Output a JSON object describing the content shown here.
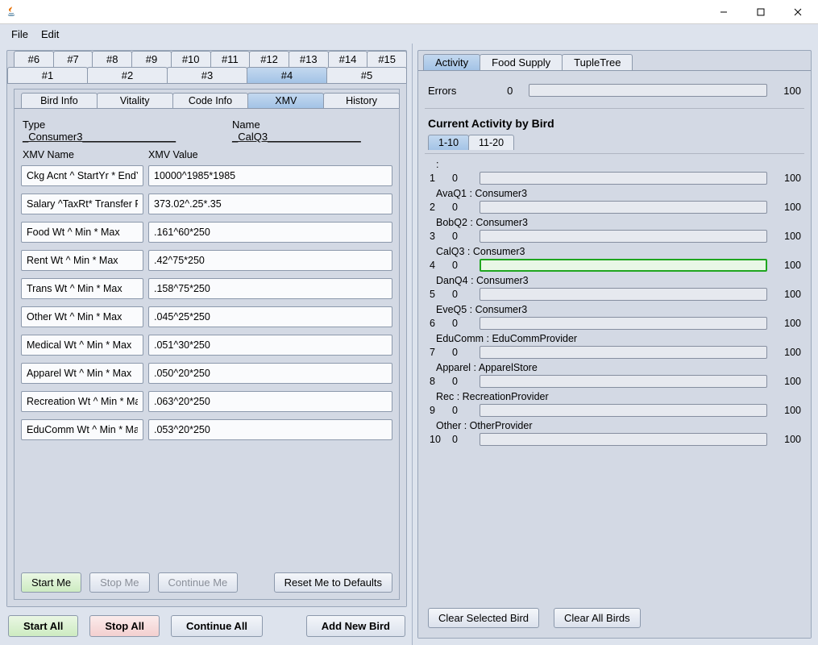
{
  "window": {
    "min": "—",
    "max": "▢",
    "close": "✕"
  },
  "menu": {
    "file": "File",
    "edit": "Edit"
  },
  "numTabs": {
    "row1": [
      "#6",
      "#7",
      "#8",
      "#9",
      "#10",
      "#11",
      "#12",
      "#13",
      "#14",
      "#15"
    ],
    "row2": [
      "#1",
      "#2",
      "#3",
      "#4",
      "#5"
    ],
    "active": "#4"
  },
  "infoTabs": {
    "items": [
      "Bird Info",
      "Vitality",
      "Code Info",
      "XMV",
      "History"
    ],
    "active": "XMV"
  },
  "typeLine": {
    "typeLabel": "Type",
    "typeVal": "_Consumer3________________",
    "nameLabel": "Name",
    "nameVal": "_CalQ3________________"
  },
  "xmvHeader": {
    "name": "XMV Name",
    "value": "XMV Value"
  },
  "xmv": [
    {
      "k": "Ckg Acnt ^ StartYr * EndYr",
      "v": "10000^1985*1985"
    },
    {
      "k": "Salary ^TaxRt* Transfer Rt",
      "v": "373.02^.25*.35"
    },
    {
      "k": "Food Wt ^ Min * Max",
      "v": ".161^60*250"
    },
    {
      "k": "Rent Wt ^ Min * Max",
      "v": ".42^75*250"
    },
    {
      "k": "Trans Wt ^ Min * Max",
      "v": ".158^75*250"
    },
    {
      "k": "Other Wt ^ Min * Max",
      "v": ".045^25*250"
    },
    {
      "k": "Medical Wt ^ Min * Max",
      "v": ".051^30*250"
    },
    {
      "k": "Apparel Wt ^ Min * Max",
      "v": ".050^20*250"
    },
    {
      "k": "Recreation Wt ^ Min * Max",
      "v": ".063^20*250"
    },
    {
      "k": "EduComm Wt ^ Min * Max",
      "v": ".053^20*250"
    }
  ],
  "leftBtns": {
    "start": "Start Me",
    "stop": "Stop Me",
    "cont": "Continue Me",
    "reset": "Reset Me to Defaults"
  },
  "globalBtns": {
    "startAll": "Start All",
    "stopAll": "Stop All",
    "contAll": "Continue All",
    "add": "Add New Bird"
  },
  "rightTabs": {
    "items": [
      "Activity",
      "Food Supply",
      "TupleTree"
    ],
    "active": "Activity"
  },
  "errors": {
    "label": "Errors",
    "lo": "0",
    "hi": "100"
  },
  "activityTitle": "Current Activity by Bird",
  "rangeTabs": {
    "items": [
      "1-10",
      "11-20"
    ],
    "active": "1-10"
  },
  "birds": [
    {
      "idx": "1",
      "name": ":",
      "lo": "0",
      "hi": "100",
      "hl": false
    },
    {
      "idx": "2",
      "name": "AvaQ1 : Consumer3",
      "lo": "0",
      "hi": "100",
      "hl": false
    },
    {
      "idx": "3",
      "name": "BobQ2 : Consumer3",
      "lo": "0",
      "hi": "100",
      "hl": false
    },
    {
      "idx": "4",
      "name": "CalQ3 : Consumer3",
      "lo": "0",
      "hi": "100",
      "hl": true
    },
    {
      "idx": "5",
      "name": "DanQ4 : Consumer3",
      "lo": "0",
      "hi": "100",
      "hl": false
    },
    {
      "idx": "6",
      "name": "EveQ5 : Consumer3",
      "lo": "0",
      "hi": "100",
      "hl": false
    },
    {
      "idx": "7",
      "name": "EduComm : EduCommProvider",
      "lo": "0",
      "hi": "100",
      "hl": false
    },
    {
      "idx": "8",
      "name": "Apparel : ApparelStore",
      "lo": "0",
      "hi": "100",
      "hl": false
    },
    {
      "idx": "9",
      "name": "Rec : RecreationProvider",
      "lo": "0",
      "hi": "100",
      "hl": false
    },
    {
      "idx": "10",
      "name": "Other : OtherProvider",
      "lo": "0",
      "hi": "100",
      "hl": false
    }
  ],
  "clearBtns": {
    "sel": "Clear Selected Bird",
    "all": "Clear All Birds"
  }
}
